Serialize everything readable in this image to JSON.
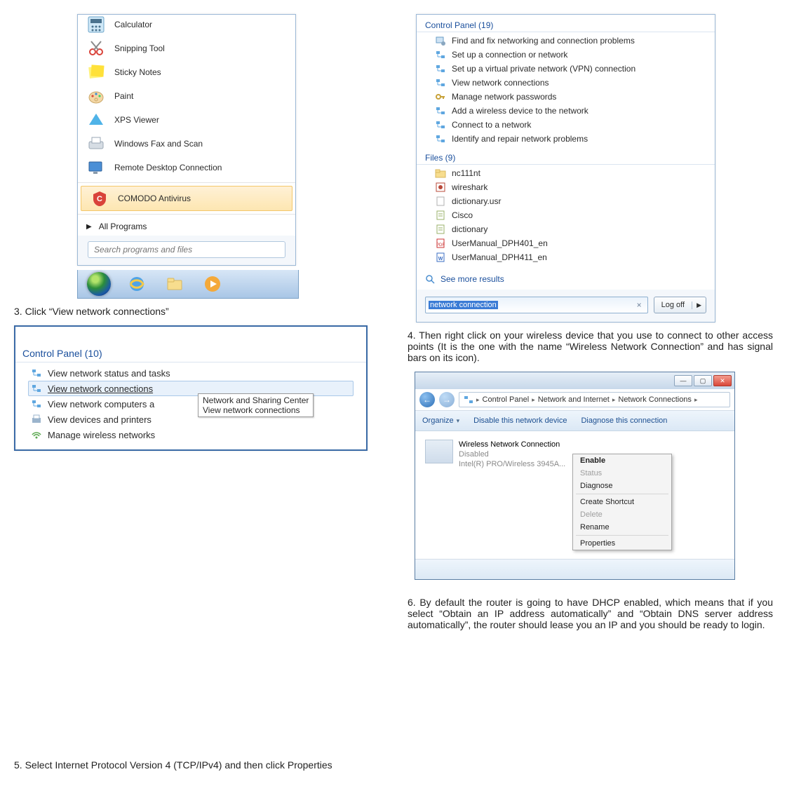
{
  "start_menu": {
    "programs": [
      {
        "label": "Calculator",
        "icon": "calculator"
      },
      {
        "label": "Snipping Tool",
        "icon": "scissors"
      },
      {
        "label": "Sticky Notes",
        "icon": "sticky"
      },
      {
        "label": "Paint",
        "icon": "paint"
      },
      {
        "label": "XPS Viewer",
        "icon": "xps"
      },
      {
        "label": "Windows Fax and Scan",
        "icon": "fax"
      },
      {
        "label": "Remote Desktop Connection",
        "icon": "rdp"
      },
      {
        "label": "COMODO Antivirus",
        "icon": "comodo"
      }
    ],
    "all_programs": "All Programs",
    "search_placeholder": "Search programs and files"
  },
  "search_results": {
    "sections": [
      {
        "title": "Control Panel (19)",
        "items": [
          {
            "label": "Find and fix networking and connection problems",
            "icon": "wrench"
          },
          {
            "label": "Set up a connection or network",
            "icon": "net"
          },
          {
            "label": "Set up a virtual private network (VPN) connection",
            "icon": "net"
          },
          {
            "label": "View network connections",
            "icon": "net"
          },
          {
            "label": "Manage network passwords",
            "icon": "key"
          },
          {
            "label": "Add a wireless device to the network",
            "icon": "net"
          },
          {
            "label": "Connect to a network",
            "icon": "net"
          },
          {
            "label": "Identify and repair network problems",
            "icon": "net"
          }
        ]
      },
      {
        "title": "Files (9)",
        "items": [
          {
            "label": "nc111nt",
            "icon": "folder"
          },
          {
            "label": "wireshark",
            "icon": "app"
          },
          {
            "label": "dictionary.usr",
            "icon": "file"
          },
          {
            "label": "Cisco",
            "icon": "doc"
          },
          {
            "label": "dictionary",
            "icon": "doc"
          },
          {
            "label": "UserManual_DPH401_en",
            "icon": "pdf"
          },
          {
            "label": "UserManual_DPH411_en",
            "icon": "word"
          }
        ]
      }
    ],
    "see_more": "See more results",
    "query": "network connection",
    "logoff": "Log off"
  },
  "captions": {
    "step3": "3. Click “View network connections”",
    "step4": "4. Then right click on your wireless device that you use to connect to other access points (It is the one with the name “Wireless Network Connection” and has signal bars on its icon).",
    "step5": "5. Select Internet Protocol Version 4 (TCP/IPv4) and then click Properties",
    "step6": "6. By default the router is going to have DHCP enabled, which means that if you select “Obtain an IP address automatically” and “Obtain DNS server address automatically”, the router should lease you an IP and you should be ready to login."
  },
  "cp10": {
    "header": "Control Panel (10)",
    "items": [
      "View network status and tasks",
      "View network connections",
      "View network computers a",
      "View devices and printers",
      "Manage wireless networks"
    ],
    "tooltip": [
      "Network and Sharing Center",
      "View network connections"
    ]
  },
  "netwin": {
    "breadcrumb": [
      "Control Panel",
      "Network and Internet",
      "Network Connections"
    ],
    "toolbar": {
      "organize": "Organize",
      "disable": "Disable this network device",
      "diagnose": "Diagnose this connection"
    },
    "adapter": {
      "name": "Wireless Network Connection",
      "status": "Disabled",
      "device": "Intel(R) PRO/Wireless 3945A..."
    },
    "menu": [
      "Enable",
      "Status",
      "Diagnose",
      "Create Shortcut",
      "Delete",
      "Rename",
      "Properties"
    ]
  }
}
